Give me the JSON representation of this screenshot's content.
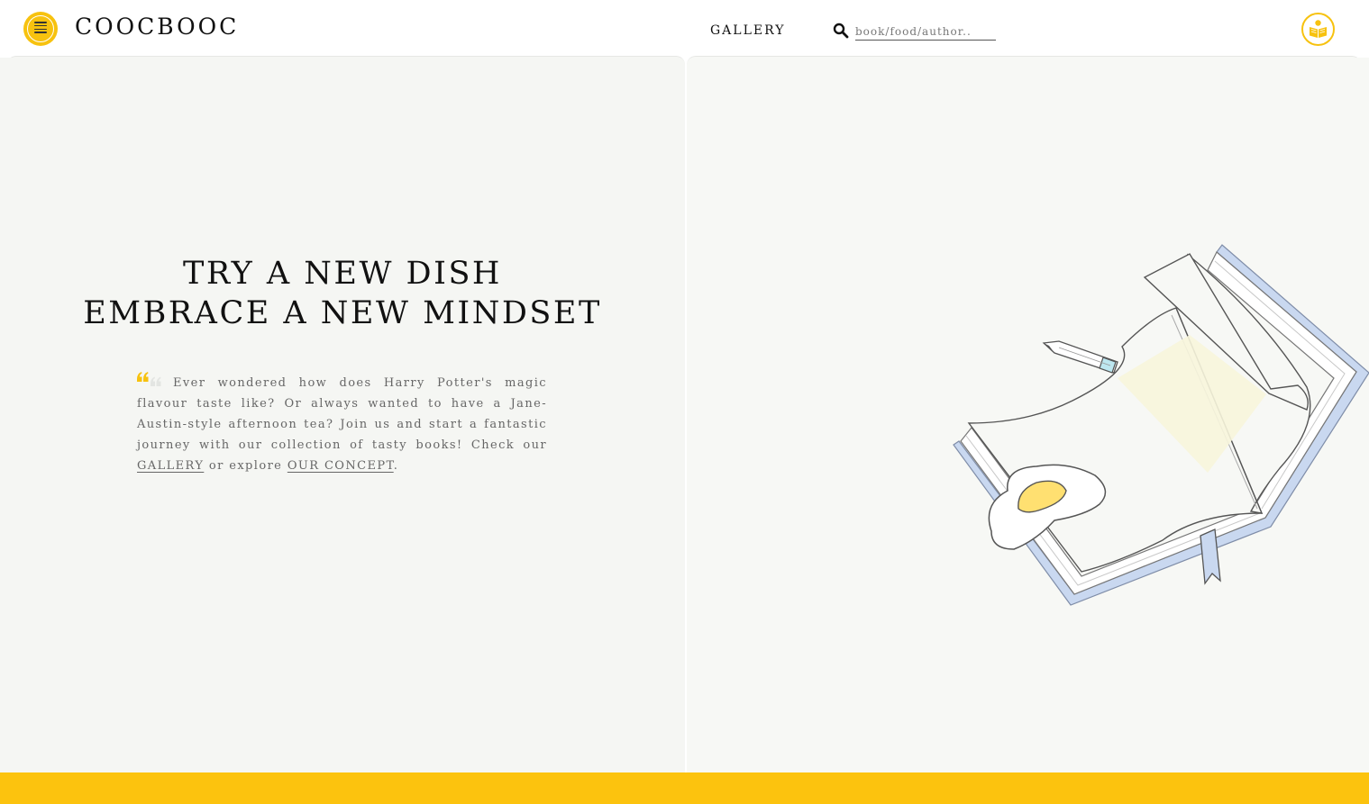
{
  "header": {
    "brand": "COOCBOOC",
    "nav_gallery": "GALLERY",
    "search_placeholder": "book/food/author.."
  },
  "hero": {
    "title_line1": "TRY A NEW DISH",
    "title_line2": "EMBRACE A NEW MINDSET",
    "quote_text": "Ever wondered how does Harry Potter's magic flavour taste like? Or always wanted to have a Jane-Austin-style afternoon tea? Join us and start a fantastic journey with our collection of tasty books! Check our",
    "quote_link_gallery": "GALLERY",
    "quote_middle": "or explore",
    "quote_link_concept": "OUR CONCEPT",
    "quote_end": "."
  },
  "icons": {
    "menu": "menu-icon",
    "search": "search-icon",
    "reader": "reader-book-icon",
    "quote": "quote-mark-icon"
  },
  "colors": {
    "accent": "#fcc30e",
    "panel_bg": "#f5f6f3",
    "text": "#111111",
    "muted_text": "#666666"
  }
}
